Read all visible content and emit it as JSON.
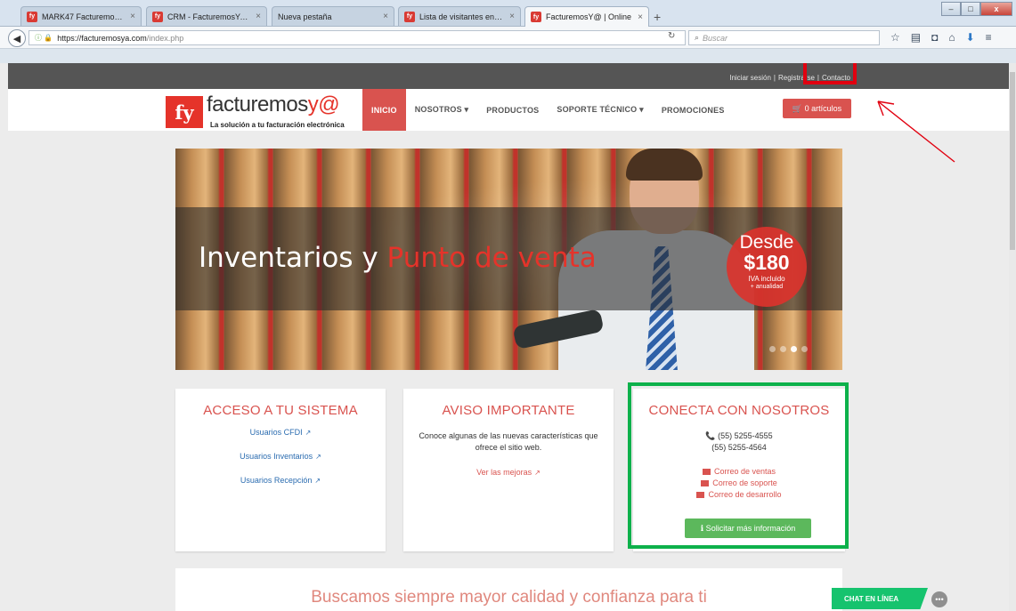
{
  "browser": {
    "tabs": [
      {
        "title": "MARK47 FacturemosY@ | L...",
        "close": "×"
      },
      {
        "title": "CRM - FacturemosYA 5.0",
        "close": "×"
      },
      {
        "title": "Nueva pestaña",
        "close": "×"
      },
      {
        "title": "Lista de visitantes en esper...",
        "close": "×"
      },
      {
        "title": "FacturemosY@ | Online",
        "close": "×"
      }
    ],
    "new_tab": "+",
    "url_host": "https://facturemosya.com",
    "url_path": "/index.php",
    "search_placeholder": "Buscar"
  },
  "site": {
    "top_links": {
      "login": "Iniciar sesión",
      "sep1": "|",
      "register": "Registrarse",
      "sep2": "|",
      "contact": "Contacto"
    },
    "logo": {
      "mark": "fy",
      "name": "facturemos",
      "name_accent": "y@",
      "tagline": "La solución a tu facturación electrónica"
    },
    "nav": [
      {
        "label": "INICIO"
      },
      {
        "label": "NOSOTROS ▾"
      },
      {
        "label": "PRODUCTOS"
      },
      {
        "label": "SOPORTE TÉCNICO ▾"
      },
      {
        "label": "PROMOCIONES"
      }
    ],
    "cart": "🛒 0 artículos",
    "banner": {
      "title_part1": "Inventarios y ",
      "title_accent": "Punto de venta",
      "badge_l1": "Desde",
      "badge_l2": "$180",
      "badge_l3": "IVA incluido",
      "badge_l4": "+ anualidad"
    },
    "card1": {
      "title": "ACCESO A TU SISTEMA",
      "links": [
        "Usuarios CFDI",
        "Usuarios Inventarios",
        "Usuarios Recepción"
      ]
    },
    "card2": {
      "title": "AVISO IMPORTANTE",
      "text": "Conoce algunas de las nuevas características que ofrece el sitio web.",
      "link": "Ver las mejoras"
    },
    "card3": {
      "title": "CONECTA CON NOSOTROS",
      "phone1": "📞 (55) 5255-4555",
      "phone2": "(55) 5255-4564",
      "mails": [
        "Correo de ventas",
        "Correo de soporte",
        "Correo de desarrollo"
      ],
      "button": "ℹ Solicitar más información"
    },
    "bottom_title": "Buscamos siempre mayor calidad y confianza para ti",
    "chat": "CHAT EN LÍNEA"
  },
  "colors": {
    "brand_red": "#d9534f",
    "highlight_red": "#e1000f",
    "highlight_green": "#0db14b"
  }
}
